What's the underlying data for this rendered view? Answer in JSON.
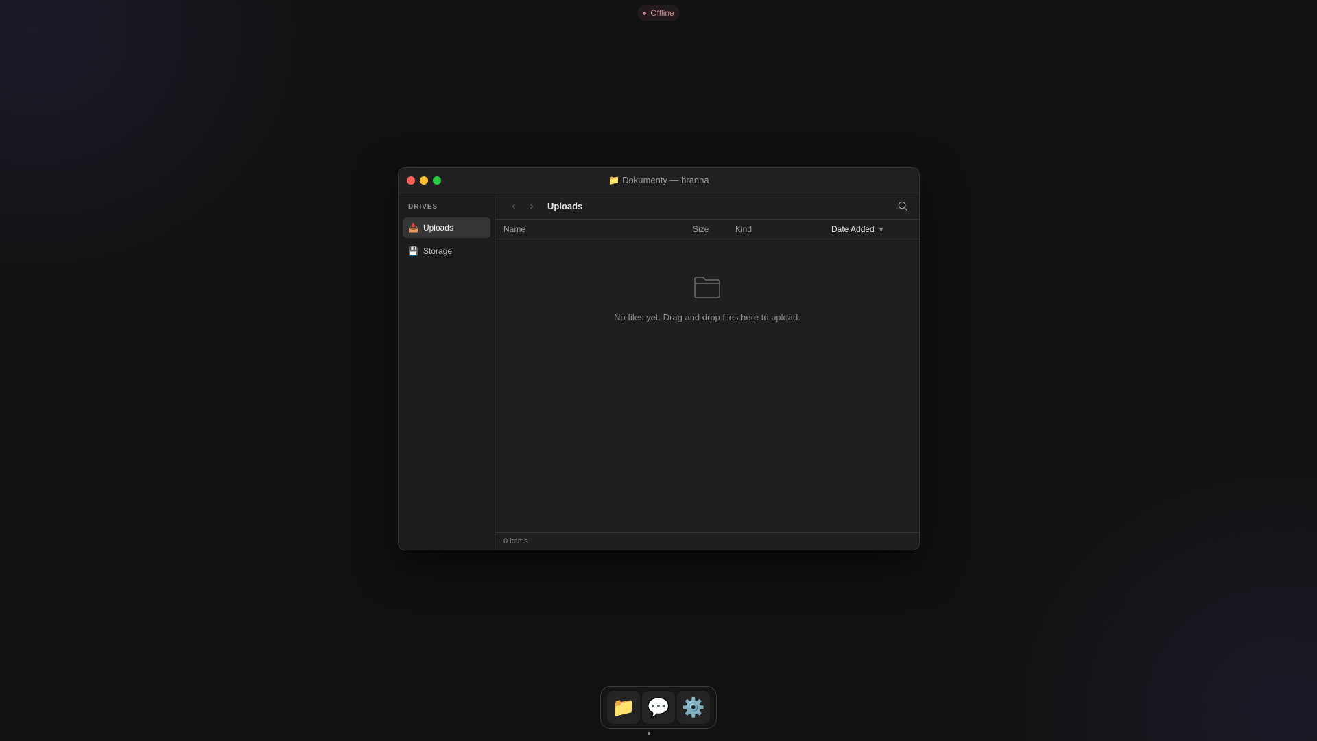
{
  "status": {
    "label": "Offline",
    "color": "#c98a92"
  },
  "window": {
    "title_icon": "📁",
    "title": "Dokumenty — branna"
  },
  "sidebar": {
    "heading": "DRIVES",
    "items": [
      {
        "icon": "📥",
        "label": "Uploads",
        "active": true
      },
      {
        "icon": "💾",
        "label": "Storage",
        "active": false
      }
    ]
  },
  "toolbar": {
    "back": "‹",
    "forward": "›",
    "breadcrumb": "Uploads"
  },
  "columns": {
    "name": "Name",
    "size": "Size",
    "kind": "Kind",
    "date_added": "Date Added",
    "sort_indicator": "▾"
  },
  "empty_state": {
    "message": "No files yet. Drag and drop files here to upload."
  },
  "statusbar": {
    "count": "0 items"
  },
  "dock": [
    {
      "icon": "📁",
      "name": "files"
    },
    {
      "icon": "💬",
      "name": "messages"
    },
    {
      "icon": "⚙️",
      "name": "settings"
    }
  ]
}
